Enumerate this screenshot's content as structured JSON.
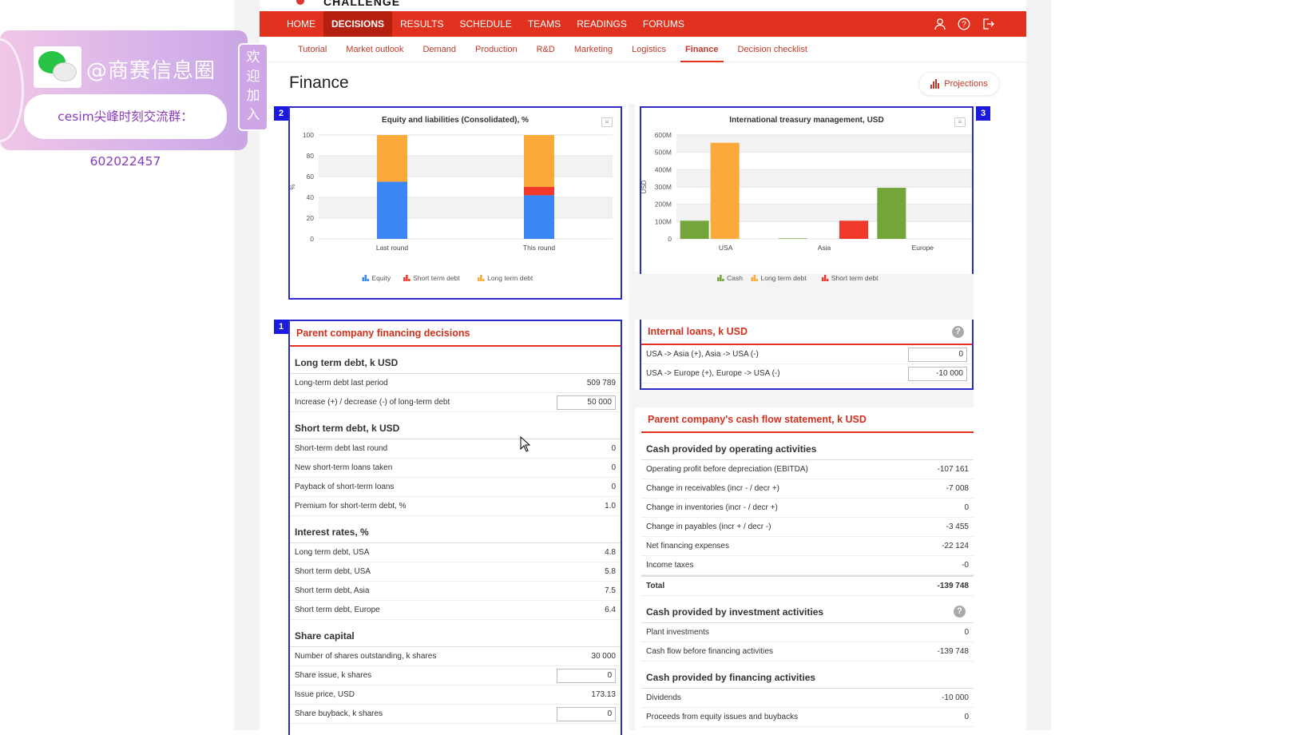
{
  "app": {
    "brand": "CHALLENGE"
  },
  "nav": {
    "items": [
      "HOME",
      "DECISIONS",
      "RESULTS",
      "SCHEDULE",
      "TEAMS",
      "READINGS",
      "FORUMS"
    ],
    "active_index": 1,
    "icons": [
      "user-icon",
      "help-icon",
      "logout-icon"
    ]
  },
  "subnav": {
    "items": [
      "Tutorial",
      "Market outlook",
      "Demand",
      "Production",
      "R&D",
      "Marketing",
      "Logistics",
      "Finance",
      "Decision checklist"
    ],
    "active_index": 7
  },
  "page": {
    "title": "Finance",
    "projections_label": "Projections"
  },
  "badges": {
    "financing": "1",
    "equity_chart": "2",
    "treasury_chart": "3"
  },
  "chart_data": [
    {
      "type": "bar",
      "stacked": true,
      "title": "Equity and liabilities (Consolidated), %",
      "ylabel": "%",
      "categories": [
        "Last round",
        "This round"
      ],
      "ylim": [
        0,
        100
      ],
      "yticks": [
        0,
        20,
        40,
        60,
        80,
        100
      ],
      "series": [
        {
          "name": "Equity",
          "color": "#3b86f5",
          "values": [
            55,
            42
          ]
        },
        {
          "name": "Short term debt",
          "color": "#f0392b",
          "values": [
            0,
            8
          ]
        },
        {
          "name": "Long term debt",
          "color": "#fba93a",
          "values": [
            45,
            50
          ]
        }
      ],
      "legend_position": "bottom"
    },
    {
      "type": "bar",
      "stacked": false,
      "title": "International treasury management, USD",
      "ylabel": "USD",
      "categories": [
        "USA",
        "Asia",
        "Europe"
      ],
      "ylim": [
        0,
        600
      ],
      "yticks": [
        "0",
        "100M",
        "200M",
        "300M",
        "400M",
        "500M",
        "600M"
      ],
      "series": [
        {
          "name": "Cash",
          "color": "#73a53a",
          "values": [
            105,
            3,
            295
          ]
        },
        {
          "name": "Long term debt",
          "color": "#fba93a",
          "values": [
            555,
            0,
            0
          ]
        },
        {
          "name": "Short term debt",
          "color": "#f0392b",
          "values": [
            0,
            105,
            0
          ]
        }
      ],
      "legend_position": "bottom"
    }
  ],
  "financing": {
    "title": "Parent company financing decisions",
    "long_term": {
      "heading": "Long term debt, k USD",
      "last_label": "Long-term debt last period",
      "last_value": "509 789",
      "change_label": "Increase (+) / decrease (-) of long-term debt",
      "change_value": "50 000"
    },
    "short_term": {
      "heading": "Short term debt, k USD",
      "rows": [
        {
          "label": "Short-term debt last round",
          "value": "0"
        },
        {
          "label": "New short-term loans taken",
          "value": "0"
        },
        {
          "label": "Payback of short-term loans",
          "value": "0"
        },
        {
          "label": "Premium for short-term debt, %",
          "value": "1.0"
        }
      ]
    },
    "interest": {
      "heading": "Interest rates, %",
      "rows": [
        {
          "label": "Long term debt, USA",
          "value": "4.8"
        },
        {
          "label": "Short term debt, USA",
          "value": "5.8"
        },
        {
          "label": "Short term debt, Asia",
          "value": "7.5"
        },
        {
          "label": "Short term debt, Europe",
          "value": "6.4"
        }
      ]
    },
    "shares": {
      "heading": "Share capital",
      "outstanding_label": "Number of shares outstanding, k shares",
      "outstanding_value": "30 000",
      "issue_label": "Share issue, k shares",
      "issue_value": "0",
      "price_label": "Issue price, USD",
      "price_value": "173.13",
      "buyback_label": "Share buyback, k shares",
      "buyback_value": "0"
    }
  },
  "loans": {
    "title": "Internal loans, k USD",
    "rows": [
      {
        "label": "USA -> Asia (+), Asia -> USA (-)",
        "value": "0"
      },
      {
        "label": "USA -> Europe (+), Europe -> USA (-)",
        "value": "-10 000"
      }
    ]
  },
  "cashflow": {
    "title": "Parent company's cash flow statement, k USD",
    "operating": {
      "heading": "Cash provided by operating activities",
      "rows": [
        {
          "label": "Operating profit before depreciation (EBITDA)",
          "value": "-107 161"
        },
        {
          "label": "Change in receivables (incr - / decr +)",
          "value": "-7 008"
        },
        {
          "label": "Change in inventories (incr - / decr +)",
          "value": "0"
        },
        {
          "label": "Change in payables (incr + / decr -)",
          "value": "-3 455"
        },
        {
          "label": "Net financing expenses",
          "value": "-22 124"
        },
        {
          "label": "Income taxes",
          "value": "-0"
        }
      ],
      "total_label": "Total",
      "total_value": "-139 748"
    },
    "investment": {
      "heading": "Cash provided by investment activities",
      "rows": [
        {
          "label": "Plant investments",
          "value": "0"
        },
        {
          "label": "Cash flow before financing activities",
          "value": "-139 748"
        }
      ]
    },
    "financing": {
      "heading": "Cash provided by financing activities",
      "rows": [
        {
          "label": "Dividends",
          "value": "-10 000"
        },
        {
          "label": "Proceeds from equity issues and buybacks",
          "value": "0"
        }
      ]
    }
  },
  "watermark": {
    "handle": "@商赛信息圈",
    "group": "cesim尖峰时刻交流群：602022457",
    "tag": "欢迎加入"
  }
}
